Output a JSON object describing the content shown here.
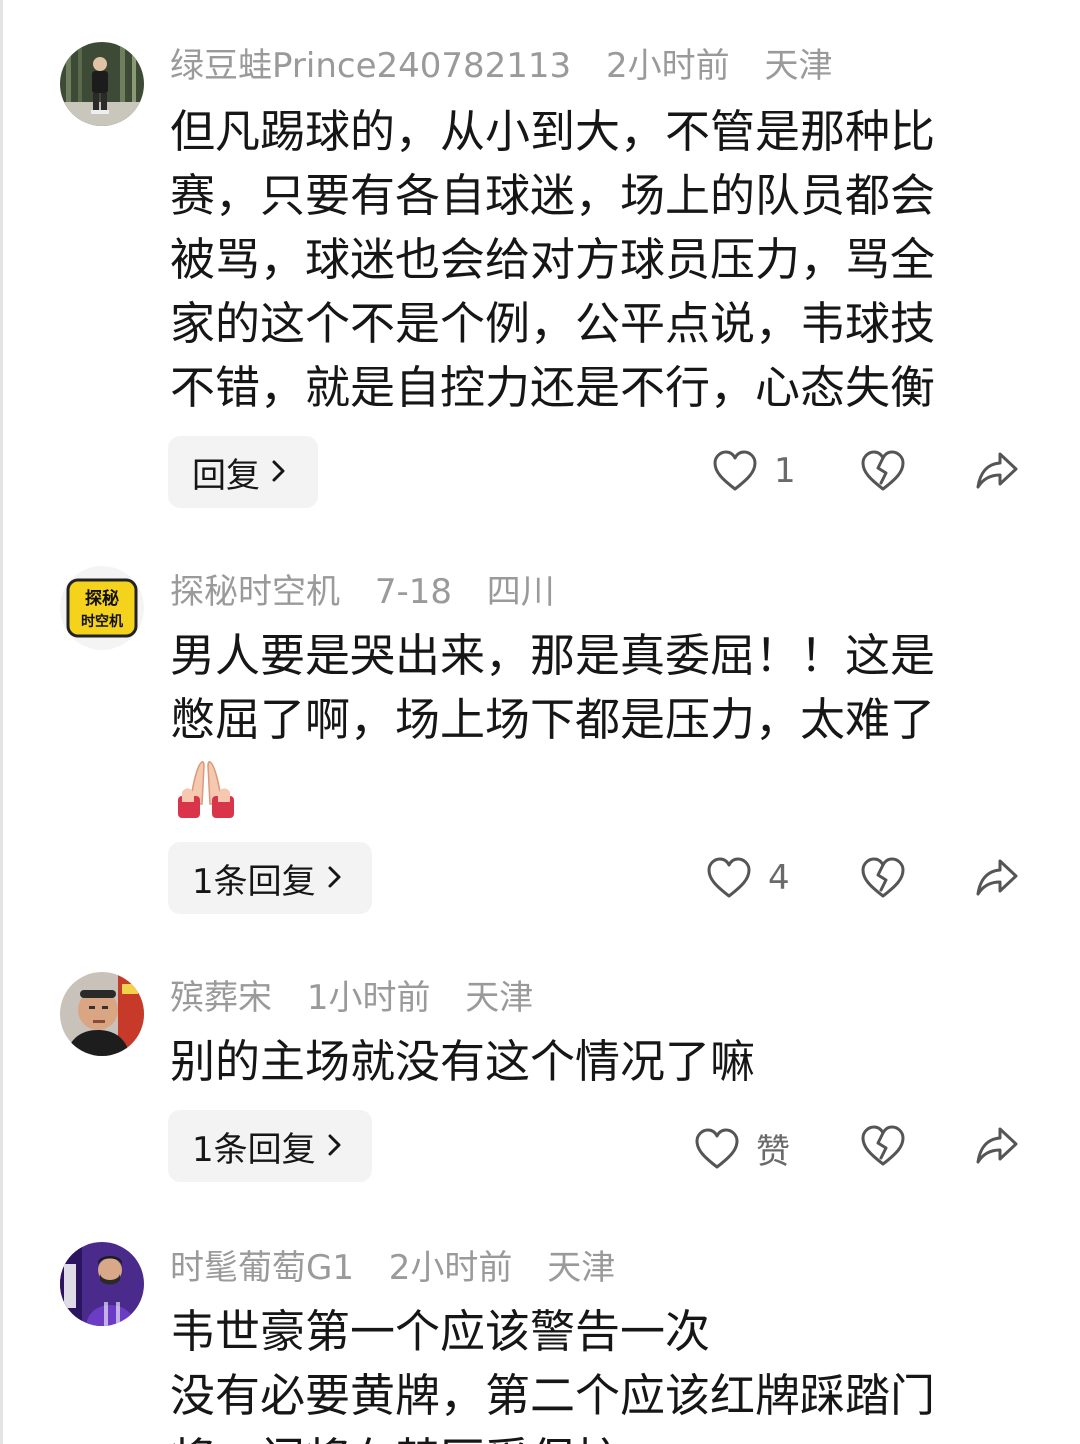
{
  "comments": [
    {
      "username": "绿豆蛙Prince240782113",
      "time": "2小时前",
      "location": "天津",
      "lines": [
        "但凡踢球的，从小到大，不管是那种比",
        "赛，只要有各自球迷，场上的队员都会",
        "被骂，球迷也会给对方球员压力，骂全",
        "家的这个不是个例，公平点说，韦球技",
        "不错，就是自控力还是不行，心态失衡"
      ],
      "reply_label": "回复",
      "like_count": "1"
    },
    {
      "username": "探秘时空机",
      "time": "7-18",
      "location": "四川",
      "avatar_text_1": "探秘",
      "avatar_text_2": "时空机",
      "lines": [
        "男人要是哭出来，那是真委屈！！这是",
        "憋屈了啊，场上场下都是压力，太难了"
      ],
      "emoji": "folded-hands",
      "reply_label": "1条回复",
      "like_count": "4"
    },
    {
      "username": "殡葬宋",
      "time": "1小时前",
      "location": "天津",
      "lines": [
        "别的主场就没有这个情况了嘛"
      ],
      "reply_label": "1条回复",
      "like_count": "赞"
    },
    {
      "username": "时髦葡萄G1",
      "time": "2小时前",
      "location": "天津",
      "lines": [
        "韦世豪第一个应该警告一次",
        "没有必要黄牌，第二个应该红牌踩踏门",
        "将，门将在禁区受保护"
      ]
    }
  ],
  "icons": {
    "like": "heart-outline-icon",
    "dislike": "broken-heart-icon",
    "share": "share-arrow-icon",
    "chevron": "chevron-right-icon"
  },
  "colors": {
    "meta_text": "#9a9a9a",
    "reply_bg": "#f3f3f3",
    "icon_stroke": "#555555"
  }
}
